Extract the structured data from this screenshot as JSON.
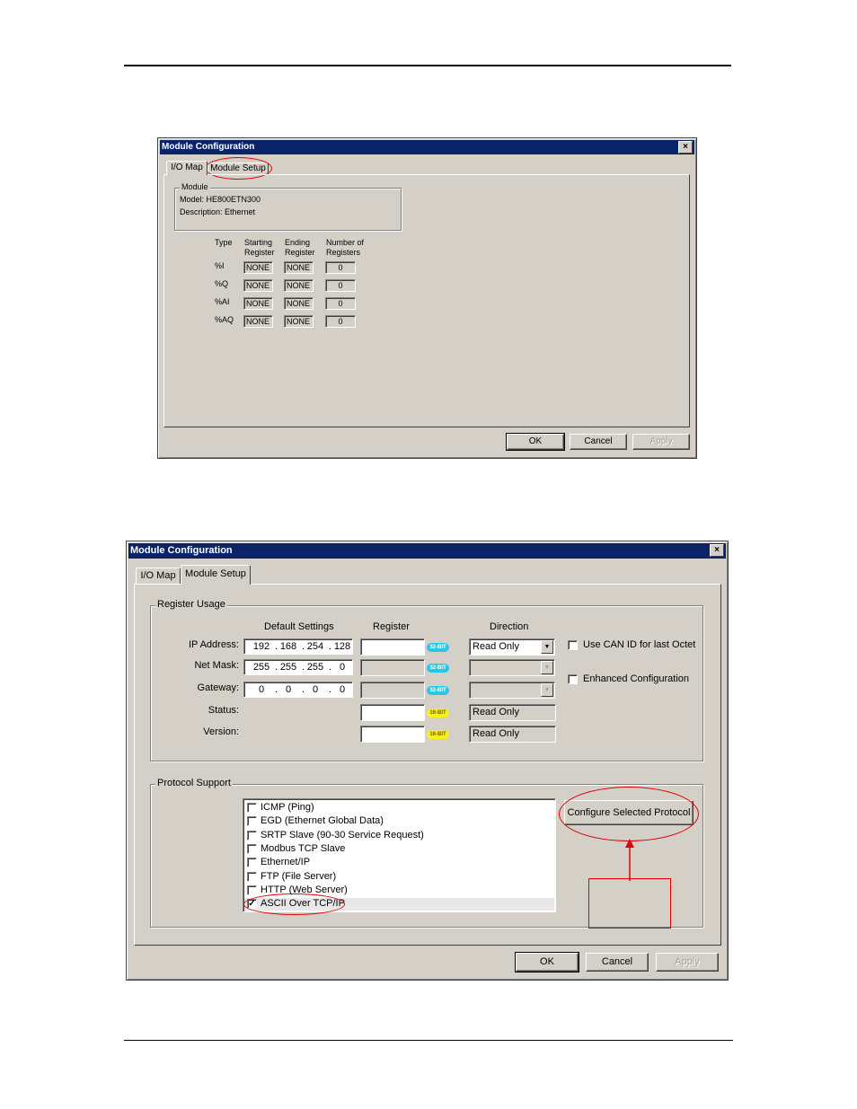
{
  "dialog1": {
    "title": "Module Configuration",
    "close": "×",
    "tabs": [
      "I/O Map",
      "Module Setup"
    ],
    "module_group": "Module",
    "model": "Model:  HE800ETN300",
    "description": "Description:  Ethernet",
    "headers": {
      "type": "Type",
      "starting": "Starting\nRegister",
      "ending": "Ending\nRegister",
      "count": "Number of\nRegisters"
    },
    "rows": [
      {
        "type": "%I",
        "start": "NONE",
        "end": "NONE",
        "count": "0"
      },
      {
        "type": "%Q",
        "start": "NONE",
        "end": "NONE",
        "count": "0"
      },
      {
        "type": "%AI",
        "start": "NONE",
        "end": "NONE",
        "count": "0"
      },
      {
        "type": "%AQ",
        "start": "NONE",
        "end": "NONE",
        "count": "0"
      }
    ],
    "buttons": {
      "ok": "OK",
      "cancel": "Cancel",
      "apply": "Apply"
    }
  },
  "dialog2": {
    "title": "Module Configuration",
    "close": "×",
    "tabs": [
      "I/O Map",
      "Module Setup"
    ],
    "register_usage": {
      "group": "Register Usage",
      "col_default": "Default Settings",
      "col_register": "Register",
      "col_direction": "Direction",
      "rows": [
        {
          "label": "IP Address:",
          "oct": [
            "192",
            "168",
            "254",
            "128"
          ],
          "badge": "32-BIT",
          "direction": "Read Only"
        },
        {
          "label": "Net Mask:",
          "oct": [
            "255",
            "255",
            "255",
            "0"
          ],
          "badge": "32-BIT",
          "direction": ""
        },
        {
          "label": "Gateway:",
          "oct": [
            "0",
            "0",
            "0",
            "0"
          ],
          "badge": "32-BIT",
          "direction": ""
        },
        {
          "label": "Status:",
          "badge": "16-BIT",
          "direction": "Read Only"
        },
        {
          "label": "Version:",
          "badge": "16-BIT",
          "direction": "Read Only"
        }
      ],
      "use_can_id": "Use CAN ID for last Octet",
      "enhanced": "Enhanced Configuration"
    },
    "protocol_support": {
      "group": "Protocol Support",
      "items": [
        {
          "label": "ICMP (Ping)",
          "checked": false
        },
        {
          "label": "EGD (Ethernet Global Data)",
          "checked": false
        },
        {
          "label": "SRTP Slave (90-30 Service Request)",
          "checked": false
        },
        {
          "label": "Modbus TCP Slave",
          "checked": false
        },
        {
          "label": "Ethernet/IP",
          "checked": false
        },
        {
          "label": "FTP (File Server)",
          "checked": false
        },
        {
          "label": "HTTP (Web Server)",
          "checked": false
        },
        {
          "label": "ASCII Over TCP/IP",
          "checked": true
        }
      ],
      "configure_button": "Configure Selected Protocol"
    },
    "buttons": {
      "ok": "OK",
      "cancel": "Cancel",
      "apply": "Apply"
    }
  },
  "colors": {
    "dialog_bg": "#d4d0c8",
    "title_bar": "#0a246a",
    "annotation": "#e00000",
    "badge32": "#25c9e6",
    "badge16": "#f3f316"
  },
  "icons": {
    "close": "close-icon",
    "dropdown": "chevron-down-icon",
    "checkbox": "checkbox-icon",
    "arrow": "up-arrow-icon"
  }
}
